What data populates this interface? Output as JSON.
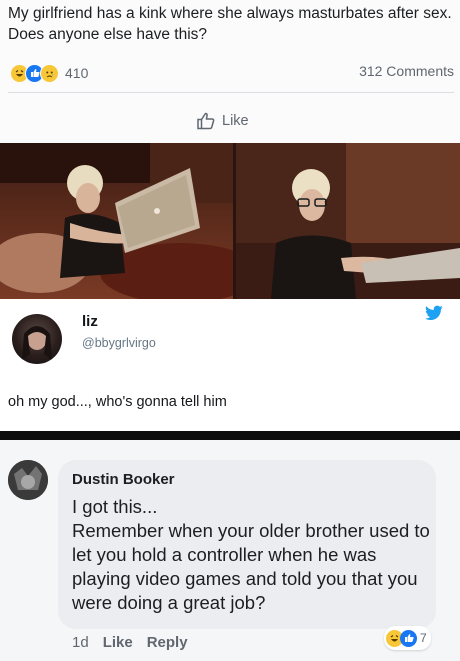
{
  "post": {
    "text": "My girlfriend has a kink where she always masturbates after sex. Does anyone else have this?",
    "reaction_count": "410",
    "comments_count": "312 Comments",
    "like_label": "Like",
    "reactions": [
      "haha",
      "like",
      "sad"
    ]
  },
  "tweet": {
    "name": "liz",
    "handle": "@bbygrlvirgo",
    "text": "oh my god..., who's gonna tell him"
  },
  "comment": {
    "name": "Dustin Booker",
    "text": "I got this...\nRemember when your older brother used to let you hold a controller when he was playing video games and told you that you were doing a great job?",
    "time": "1d",
    "like_label": "Like",
    "reply_label": "Reply",
    "reaction_count": "7",
    "reactions": [
      "haha",
      "like"
    ]
  },
  "colors": {
    "fb_blue": "#1877f2",
    "twitter_blue": "#1da1f2",
    "reaction_yellow": "#f7c738",
    "meta_gray": "#606770"
  }
}
